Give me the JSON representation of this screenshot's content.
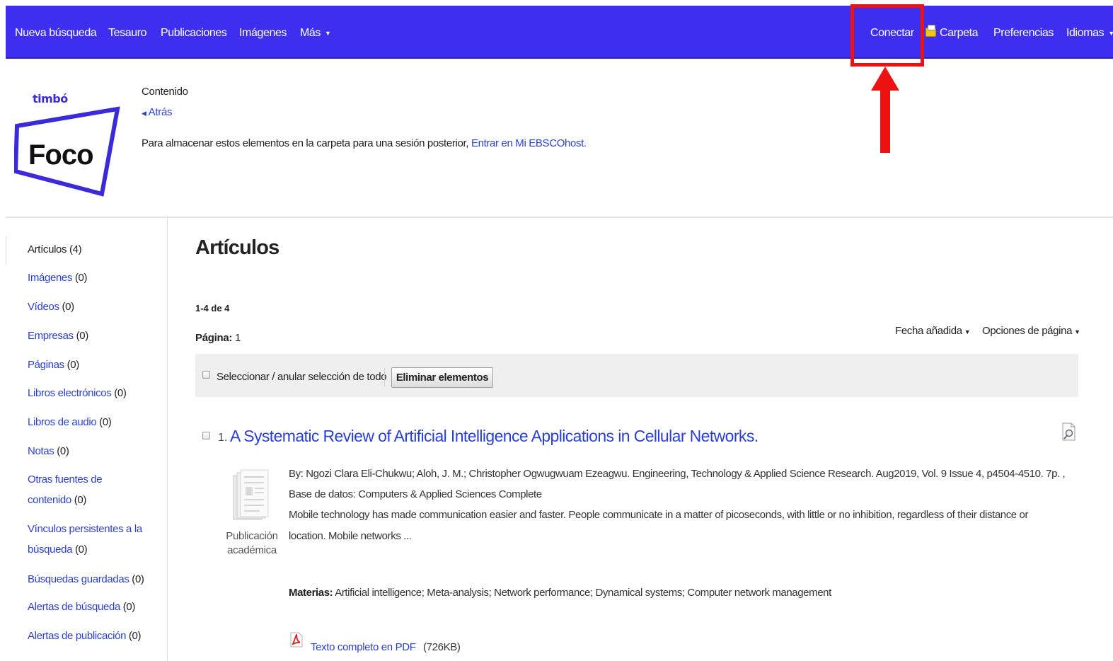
{
  "nav": {
    "items": [
      "Nueva búsqueda",
      "Tesauro",
      "Publicaciones",
      "Imágenes",
      "Más"
    ],
    "right": {
      "connect": "Conectar",
      "folder": "Carpeta",
      "preferences": "Preferencias",
      "languages": "Idiomas"
    }
  },
  "header": {
    "logo_small": "timbó",
    "logo_main": "Foco",
    "contents_label": "Contenido",
    "back": "Atrás",
    "store_message": "Para almacenar estos elementos en la carpeta para una sesión posterior,",
    "store_link": "Entrar en Mi EBSCOhost."
  },
  "sidebar": {
    "items": [
      {
        "label": "Artículos",
        "count": "(4)"
      },
      {
        "label": "Imágenes",
        "count": "(0)"
      },
      {
        "label": "Vídeos",
        "count": "(0)"
      },
      {
        "label": "Empresas",
        "count": "(0)"
      },
      {
        "label": "Páginas",
        "count": "(0)"
      },
      {
        "label": "Libros electrónicos",
        "count": "(0)"
      },
      {
        "label": "Libros de audio",
        "count": "(0)"
      },
      {
        "label": "Notas",
        "count": "(0)"
      },
      {
        "label_line1": "Otras fuentes de",
        "label_line2": "contenido",
        "count": "(0)"
      },
      {
        "label_line1": "Vínculos persistentes a la",
        "label_line2": "búsqueda",
        "count": "(0)"
      },
      {
        "label": "Búsquedas guardadas",
        "count": "(0)"
      },
      {
        "label": "Alertas de búsqueda",
        "count": "(0)"
      },
      {
        "label": "Alertas de publicación",
        "count": "(0)"
      }
    ]
  },
  "main": {
    "title": "Artículos",
    "range": "1-4 de 4",
    "page_label": "Página:",
    "page_value": "1",
    "sort_label": "Fecha añadida",
    "page_options_label": "Opciones de página",
    "select_all_label": "Seleccionar / anular selección de todo",
    "remove_button": "Eliminar elementos"
  },
  "results": [
    {
      "number": "1.",
      "title": "A Systematic Review of Artificial Intelligence Applications in Cellular Networks.",
      "byline": "By: Ngozi Clara Eli-Chukwu; Aloh, J. M.; Christopher Ogwugwuam Ezeagwu. Engineering, Technology & Applied Science Research. Aug2019, Vol. 9 Issue 4, p4504-4510. 7p. ,",
      "database": "Base de datos: Computers & Applied Sciences Complete",
      "abstract_line1": "Mobile technology has made communication easier and faster. People communicate in a matter of picoseconds, with little or no inhibition, regardless of their distance or",
      "abstract_line2": "location. Mobile networks ...",
      "pub_type_line1": "Publicación",
      "pub_type_line2": "académica",
      "subjects_label": "Materias:",
      "subjects": "Artificial intelligence; Meta-analysis; Network performance; Dynamical systems; Computer network management",
      "pdf_label": "Texto completo en PDF",
      "pdf_size": "(726KB)"
    }
  ],
  "colors": {
    "nav_bg": "#3d2ef0",
    "link": "#2a3fd0",
    "annotation_red": "#ee1111"
  }
}
